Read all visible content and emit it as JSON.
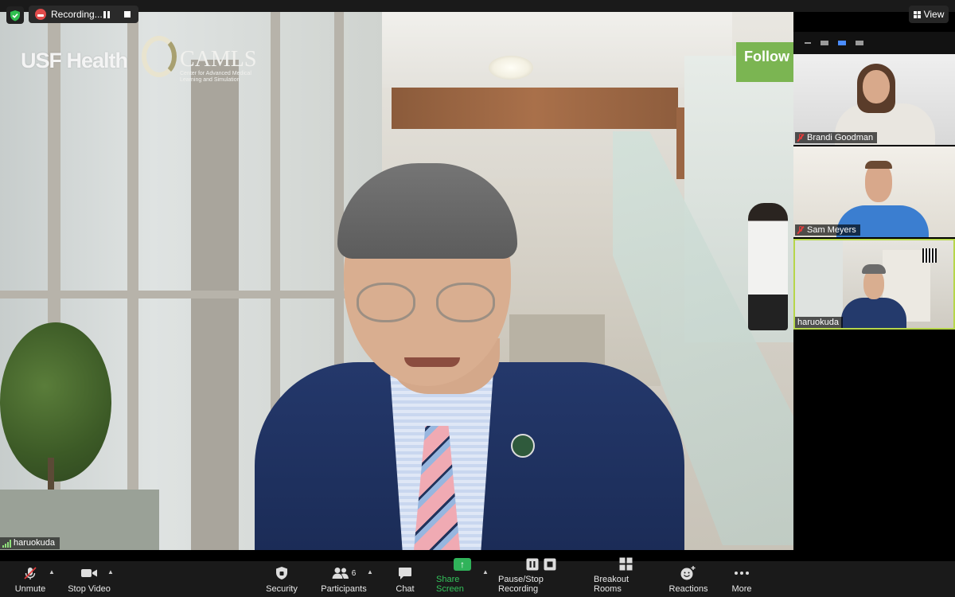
{
  "top_bar": {
    "recording_label": "Recording...",
    "view_label": "View"
  },
  "main_video": {
    "participant_name": "haruokuda",
    "background_logo_usf": "USF Health",
    "background_logo_camls": "CAMLS",
    "background_logo_camls_sub": "Center for Advanced Medical Learning and Simulation",
    "background_sign": "Follow"
  },
  "gallery": {
    "tiles": [
      {
        "name": "Brandi Goodman",
        "muted": true
      },
      {
        "name": "Sam Meyers",
        "muted": true
      },
      {
        "name": "haruokuda",
        "muted": false
      }
    ]
  },
  "toolbar": {
    "unmute": "Unmute",
    "stop_video": "Stop Video",
    "security": "Security",
    "participants": "Participants",
    "participants_count": "6",
    "chat": "Chat",
    "share_screen": "Share Screen",
    "pause_stop_recording": "Pause/Stop Recording",
    "breakout_rooms": "Breakout Rooms",
    "reactions": "Reactions",
    "more": "More"
  },
  "colors": {
    "share_green": "#33c35b",
    "active_speaker_border": "#b6d64a",
    "muted_red": "#e23b3b",
    "toolbar_bg": "#1a1a1a"
  }
}
